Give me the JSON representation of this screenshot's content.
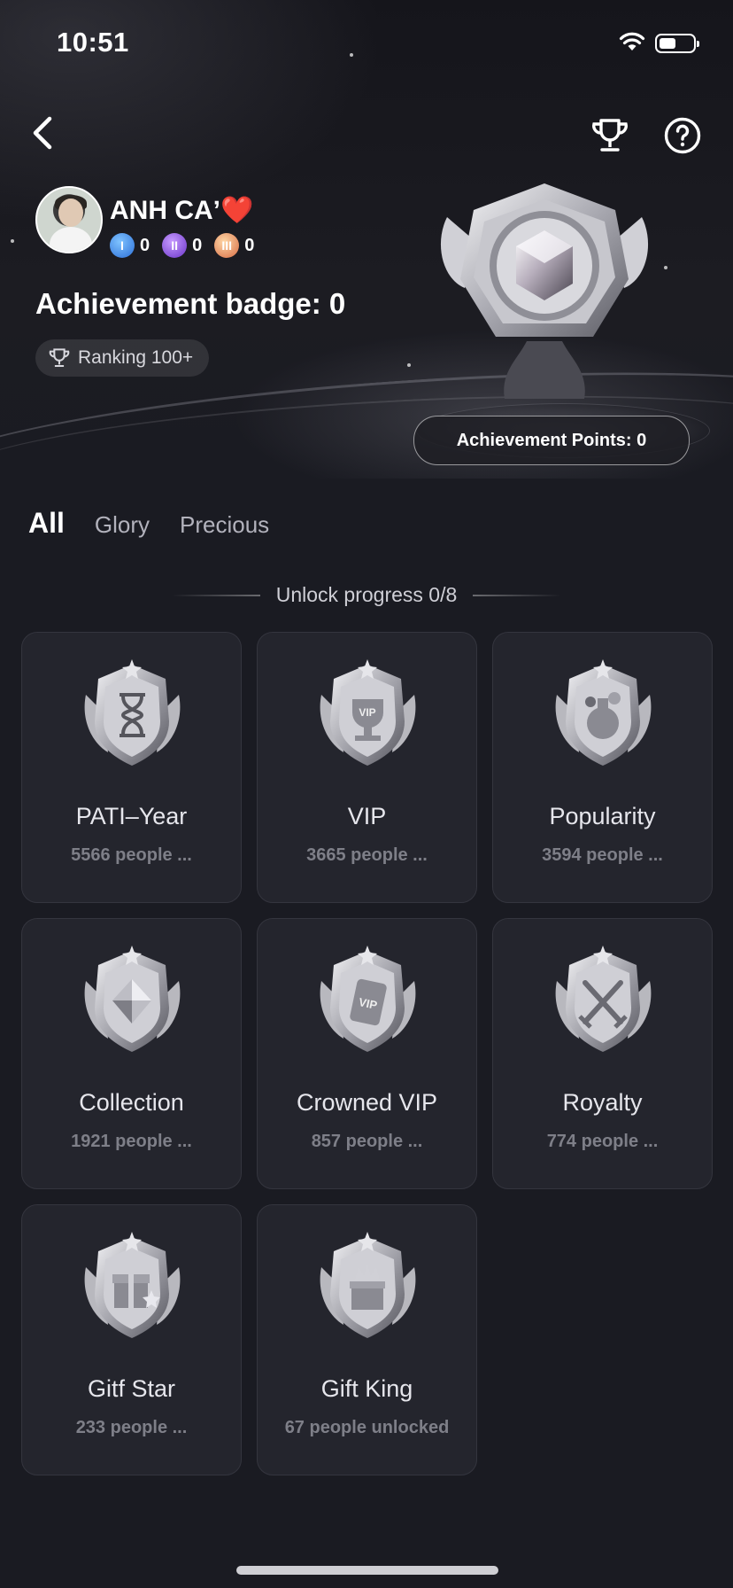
{
  "status_bar": {
    "time": "10:51"
  },
  "profile": {
    "username": "ANH CAʼ❤️",
    "medals": [
      {
        "icon": "blue-medal-icon",
        "roman": "I",
        "count": "0"
      },
      {
        "icon": "purple-medal-icon",
        "roman": "II",
        "count": "0"
      },
      {
        "icon": "gold-medal-icon",
        "roman": "III",
        "count": "0"
      }
    ],
    "badge_title": "Achievement badge: 0",
    "ranking": "Ranking 100+",
    "points": "Achievement Points: 0"
  },
  "tabs": [
    {
      "label": "All",
      "active": true
    },
    {
      "label": "Glory",
      "active": false
    },
    {
      "label": "Precious",
      "active": false
    }
  ],
  "progress": "Unlock progress 0/8",
  "badges": [
    {
      "name": "PATI–Year",
      "count": "5566 people ...",
      "icon": "hourglass-badge-icon"
    },
    {
      "name": "VIP",
      "count": "3665 people ...",
      "icon": "vip-trophy-badge-icon"
    },
    {
      "name": "Popularity",
      "count": "3594 people ...",
      "icon": "potion-badge-icon"
    },
    {
      "name": "Collection",
      "count": "1921 people ...",
      "icon": "crystal-badge-icon"
    },
    {
      "name": "Crowned VIP",
      "count": "857 people ...",
      "icon": "vip-card-badge-icon"
    },
    {
      "name": "Royalty",
      "count": "774 people ...",
      "icon": "crossed-swords-badge-icon"
    },
    {
      "name": "Gitf Star",
      "count": "233 people ...",
      "icon": "gift-star-badge-icon"
    },
    {
      "name": "Gift King",
      "count": "67 people unlocked",
      "icon": "gift-king-badge-icon"
    }
  ],
  "colors": {
    "background": "#1a1b22",
    "card": "#24252d",
    "muted_text": "#7e7f88"
  }
}
